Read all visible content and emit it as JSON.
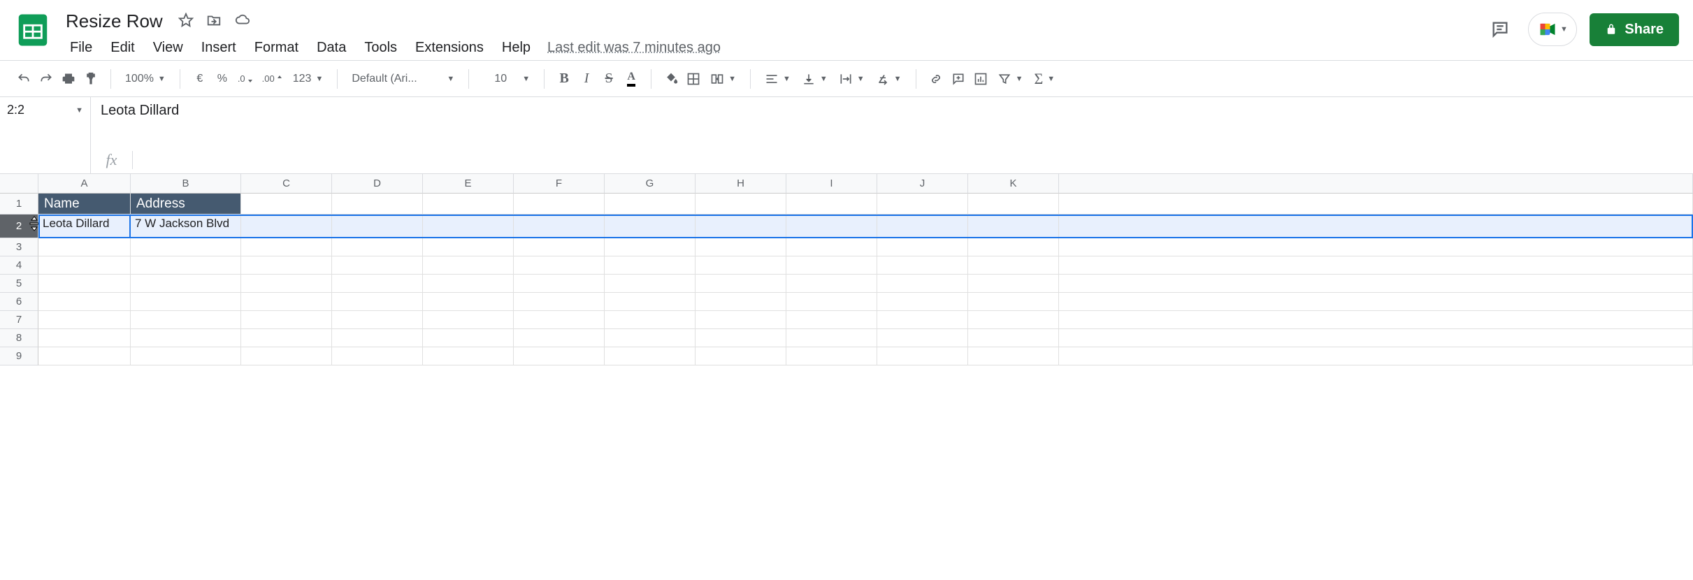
{
  "doc": {
    "title": "Resize Row"
  },
  "menubar": {
    "file": "File",
    "edit": "Edit",
    "view": "View",
    "insert": "Insert",
    "format": "Format",
    "data": "Data",
    "tools": "Tools",
    "extensions": "Extensions",
    "help": "Help"
  },
  "last_edit": "Last edit was 7 minutes ago",
  "share": {
    "label": "Share"
  },
  "toolbar": {
    "zoom": "100%",
    "currency": "€",
    "percent": "%",
    "dec_dec": ".0",
    "inc_dec": ".00",
    "more_fmt": "123",
    "font": "Default (Ari...",
    "size": "10",
    "bold": "B",
    "italic": "I",
    "strike": "S",
    "textcolor": "A"
  },
  "namebox": "2:2",
  "formula_bar": "Leota Dillard",
  "columns": [
    "A",
    "B",
    "C",
    "D",
    "E",
    "F",
    "G",
    "H",
    "I",
    "J",
    "K"
  ],
  "header_row": {
    "A": "Name",
    "B": "Address"
  },
  "data_row": {
    "A": "Leota Dillard",
    "B": "7 W Jackson Blvd"
  },
  "row_numbers": [
    "1",
    "2",
    "3",
    "4",
    "5",
    "6",
    "7",
    "8",
    "9"
  ]
}
